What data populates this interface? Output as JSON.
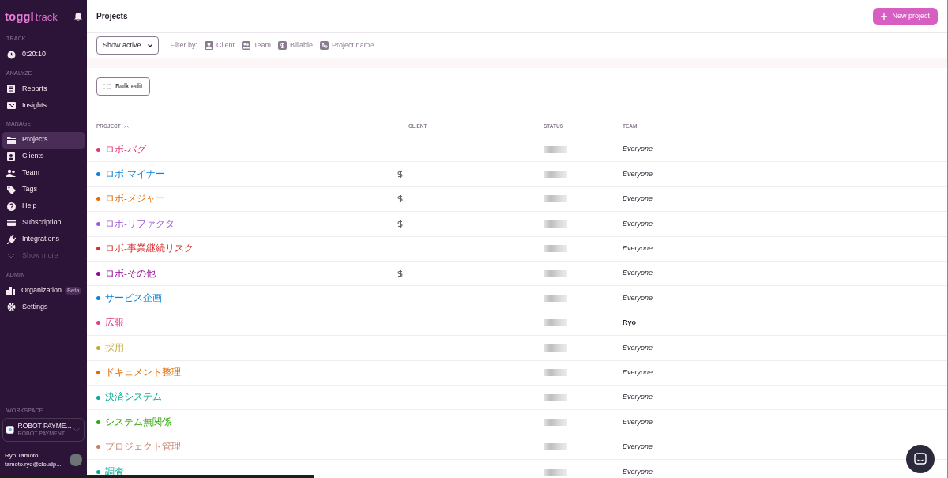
{
  "sidebar": {
    "logo": {
      "brand": "toggl",
      "product": "track"
    },
    "sections": [
      {
        "label": "TRACK",
        "items": [
          {
            "kind": "link",
            "label": "0:20:10",
            "selected": false
          }
        ]
      },
      {
        "label": "ANALYZE",
        "items": [
          {
            "kind": "link",
            "label": "Reports",
            "selected": false
          },
          {
            "kind": "link",
            "label": "Insights",
            "selected": false
          }
        ]
      },
      {
        "label": "MANAGE",
        "items": [
          {
            "kind": "link",
            "label": "Projects",
            "selected": true
          },
          {
            "kind": "link",
            "label": "Clients",
            "selected": false
          },
          {
            "kind": "link",
            "label": "Team",
            "selected": false
          },
          {
            "kind": "link",
            "label": "Tags",
            "selected": false
          },
          {
            "kind": "link",
            "label": "Help",
            "selected": false
          },
          {
            "kind": "link",
            "label": "Subscription",
            "selected": false
          },
          {
            "kind": "link",
            "label": "Integrations",
            "selected": false
          },
          {
            "kind": "expander",
            "label": "Show more",
            "selected": false
          }
        ]
      },
      {
        "label": "ADMIN",
        "items": [
          {
            "kind": "link",
            "label": "Organization",
            "badge": "Beta",
            "selected": false
          },
          {
            "kind": "link",
            "label": "Settings",
            "selected": false
          }
        ]
      }
    ],
    "workspace": {
      "label": "WORKSPACE",
      "name": "ROBOT PAYME...",
      "subtitle": "ROBOT PAYMENT"
    },
    "user": {
      "name": "Ryo Tamoto",
      "email": "tamoto.ryo@cloudp..."
    }
  },
  "header": {
    "title": "Projects",
    "new_button": "New project"
  },
  "filters": {
    "status_select": "Show active",
    "filter_label": "Filter by:",
    "chips": [
      "Client",
      "Team",
      "Billable",
      "Project name"
    ]
  },
  "bulk_edit": "Bulk edit",
  "table": {
    "columns": [
      "PROJECT",
      "CLIENT",
      "STATUS",
      "TEAM"
    ],
    "rows": [
      {
        "name": "ロボ-バグ",
        "color": "#e0356f",
        "billable": false,
        "team": "Everyone",
        "team_default": true
      },
      {
        "name": "ロボ-マイナー",
        "color": "#0b83d9",
        "billable": true,
        "team": "Everyone",
        "team_default": true
      },
      {
        "name": "ロボ-メジャー",
        "color": "#e36a00",
        "billable": true,
        "team": "Everyone",
        "team_default": true
      },
      {
        "name": "ロボ-リファクタ",
        "color": "#9e5bd9",
        "billable": true,
        "team": "Everyone",
        "team_default": true
      },
      {
        "name": "ロボ-事業継続リスク",
        "color": "#d92b2b",
        "billable": false,
        "team": "Everyone",
        "team_default": true
      },
      {
        "name": "ロボ-その他",
        "color": "#990099",
        "billable": true,
        "team": "Everyone",
        "team_default": true
      },
      {
        "name": "サービス企画",
        "color": "#0b83d9",
        "billable": false,
        "team": "Everyone",
        "team_default": true
      },
      {
        "name": "広報",
        "color": "#d94182",
        "billable": false,
        "team": "Ryo",
        "team_default": false
      },
      {
        "name": "採用",
        "color": "#bfa835",
        "billable": false,
        "team": "Everyone",
        "team_default": true
      },
      {
        "name": "ドキュメント整理",
        "color": "#e36a00",
        "billable": false,
        "team": "Everyone",
        "team_default": true
      },
      {
        "name": "決済システム",
        "color": "#06a893",
        "billable": false,
        "team": "Everyone",
        "team_default": true
      },
      {
        "name": "システム無関係",
        "color": "#2da608",
        "billable": false,
        "team": "Everyone",
        "team_default": true
      },
      {
        "name": "プロジェクト管理",
        "color": "#c9806b",
        "billable": false,
        "team": "Everyone",
        "team_default": true
      },
      {
        "name": "調査",
        "color": "#06a893",
        "billable": false,
        "team": "Everyone",
        "team_default": true
      }
    ]
  }
}
